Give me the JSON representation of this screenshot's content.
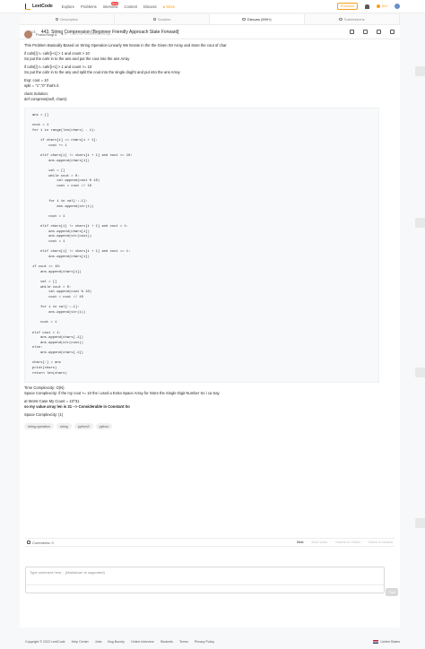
{
  "nav": {
    "brand": "LeetCode",
    "items": [
      "Explore",
      "Problems",
      "Interview",
      "Contest",
      "Discuss"
    ],
    "interview_badge": "New",
    "store": "Store",
    "premium": "Premium",
    "coins": "814"
  },
  "tabs": [
    {
      "label": "Description"
    },
    {
      "label": "Solution"
    },
    {
      "label": "Discuss (999+)"
    },
    {
      "label": "Submissions"
    }
  ],
  "header": {
    "back": "Back",
    "title": "443. String Compression [Beginner Friendly Approach State Forward]"
  },
  "post": {
    "author": "PravinSingh1",
    "votes": "0",
    "edited": "Last Edit: a few seconds ago",
    "paragraphs": [
      [
        "This Problem Basically Based on String Operation Linearly We Iterate in the the Given Str Array and store the cout of char"
      ],
      [
        "if cahr[i] != cahr[i+1] > 1 and count > 10",
        "So put the cahr in to the ans and put the cout into the ans Array"
      ],
      [
        "if cahr[i] != cahr[i+1] > 1 and count >= 10",
        "So put the cahr in to the any and split the cout into the single dogiht and put into the ans Array"
      ],
      [
        "Exp: cout = 10",
        "split = \"1\",\"0\" that's it."
      ],
      [
        "class Solution:",
        "def compress(self, chars):"
      ]
    ],
    "code": [
      "ans = []",
      "",
      "cout = 1",
      "for i in range(len(chars) - 1):",
      "",
      "    if chars[i] == chars[i + 1]:",
      "        cout += 1",
      "",
      "    elif chars[i] != chars[i + 1] and cout >= 10:",
      "        ans.append(chars[i])",
      "",
      "        val = []",
      "        while cout > 0:",
      "            val.append(cout % 10)",
      "            cout = cout // 10",
      "",
      "",
      "        for i in val[::-1]:",
      "            ans.append(str(i))",
      "",
      "        cout = 1",
      "",
      "    elif chars[i] != chars[i + 1] and cout > 1:",
      "        ans.append(chars[i])",
      "        ans.append(str(cout))",
      "        cout = 1",
      "",
      "    elif chars[i] != chars[i + 1] and cout == 1:",
      "        ans.append(chars[i])",
      "",
      "if cout >= 10:",
      "    ans.append(chars[i])",
      "",
      "    val = []",
      "    while cout > 0:",
      "        val.append(cout % 10)",
      "        cout = cout // 10",
      "",
      "    for i in val[::-1]:",
      "        ans.append(str(i))",
      "",
      "    cout = 1",
      "",
      "elif cout > 1:",
      "    ans.append(chars[-1])",
      "    ans.append(str(cout))",
      "else:",
      "    ans.append(chars[-1])",
      "",
      "chars[:] = ans",
      "print(chars)",
      "return len(chars)"
    ],
    "after": [
      [
        "Time Complexcity: O(N)",
        "Space Complexcity: if the my cout >= 10 the i used a Extra Space Array for Store the Single Digit Number So i ca Say"
      ],
      [
        "at Worst Case My Count = 10^31",
        "so my value array len is 31 --> Considerable in Constant So"
      ],
      [
        "Space Complexcity: (1)"
      ]
    ],
    "tags": [
      "string-operation",
      "string",
      "python3",
      "python"
    ]
  },
  "comments": {
    "label": "Comments: 0",
    "sort": [
      "Best",
      "Most Votes",
      "Newest to Oldest",
      "Oldest to Newest"
    ],
    "placeholder": "Type comment here... (Markdown is supported)",
    "post": "Post"
  },
  "footer": {
    "copyright": "Copyright © 2022 LeetCode",
    "links": [
      "Help Center",
      "Jobs",
      "Bug Bounty",
      "Online Interview",
      "Students",
      "Terms",
      "Privacy Policy"
    ],
    "region": "United States"
  }
}
